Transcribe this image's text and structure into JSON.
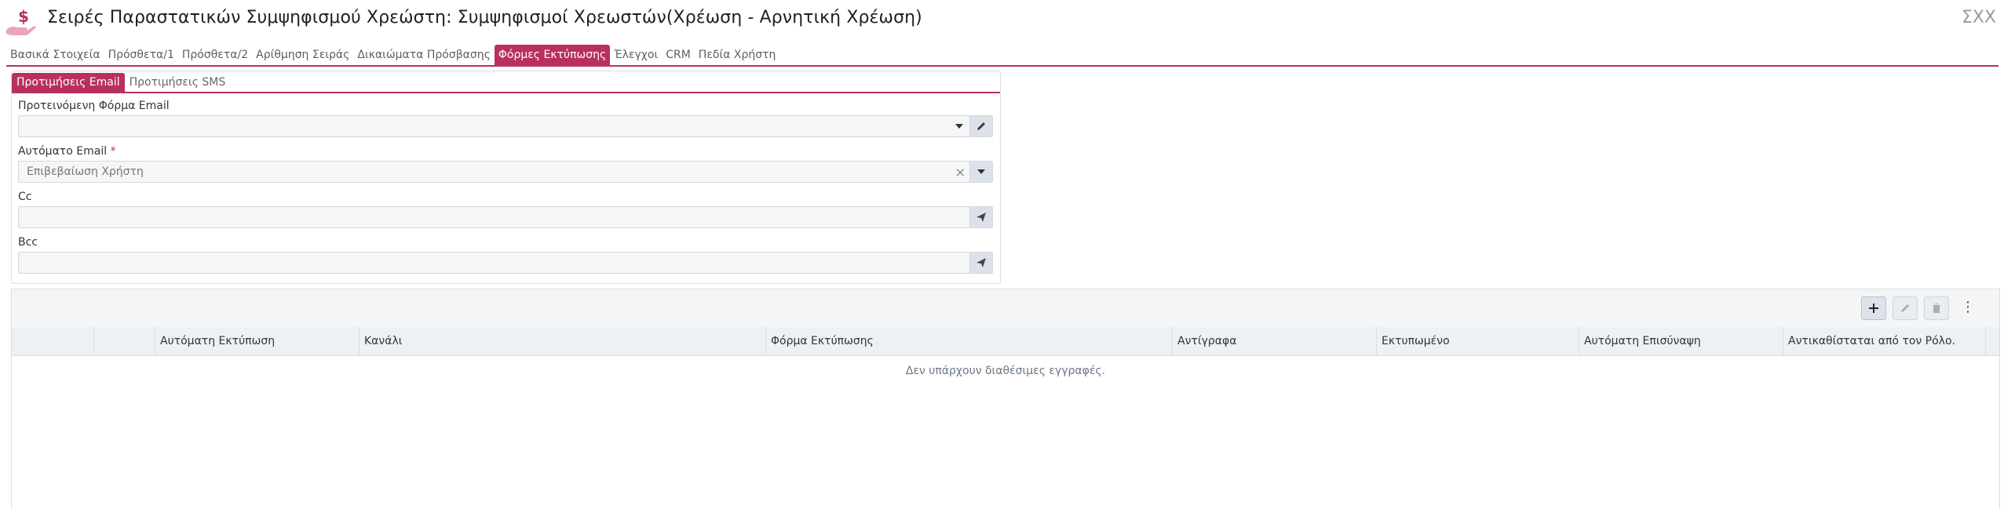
{
  "header": {
    "title": "Σειρές Παραστατικών Συμψηφισμού Χρεώστη: Συμψηφισμοί Χρεωστών(Χρέωση - Αρνητική Χρέωση)",
    "logo_icon": "hand-dollar-icon",
    "right_label": "ΣΧΧ"
  },
  "tabs": [
    {
      "label": "Βασικά Στοιχεία"
    },
    {
      "label": "Πρόσθετα/1"
    },
    {
      "label": "Πρόσθετα/2"
    },
    {
      "label": "Αρίθμηση Σειράς"
    },
    {
      "label": "Δικαιώματα Πρόσβασης"
    },
    {
      "label": "Φόρμες Εκτύπωσης",
      "active": true
    },
    {
      "label": "Έλεγχοι"
    },
    {
      "label": "CRM"
    },
    {
      "label": "Πεδία Χρήστη"
    }
  ],
  "subtabs": [
    {
      "label": "Προτιμήσεις Email",
      "active": true
    },
    {
      "label": "Προτιμήσεις SMS"
    }
  ],
  "form": {
    "email_form_label": "Προτεινόμενη Φόρμα Email",
    "email_form_value": "",
    "auto_email_label": "Αυτόματο Email",
    "required_mark": "*",
    "auto_email_value": "Επιβεβαίωση Χρήστη",
    "cc_label": "Cc",
    "cc_value": "",
    "bcc_label": "Bcc",
    "bcc_value": ""
  },
  "grid": {
    "columns": [
      "",
      "",
      "Αυτόματη Εκτύπωση",
      "Κανάλι",
      "Φόρμα Εκτύπωσης",
      "Αντίγραφα",
      "Εκτυπωμένο",
      "Αυτόματη Επισύναψη",
      "Αντικαθίσταται από τον Ρόλο."
    ],
    "empty_message": "Δεν υπάρχουν διαθέσιμες εγγραφές.",
    "toolbar_icons": [
      "plus-icon",
      "pencil-icon",
      "trash-icon",
      "kebab-menu-icon"
    ]
  },
  "colors": {
    "accent": "#b9305d",
    "border": "#d9dde3",
    "toolbar_bg": "#f3f5f7"
  }
}
